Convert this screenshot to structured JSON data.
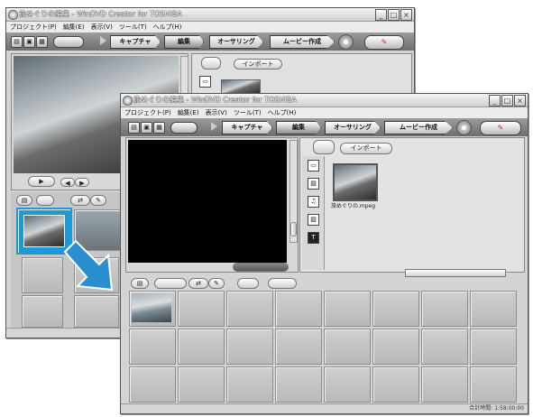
{
  "app": {
    "title": "旅めぐりの編集 - WinDVD Creator for TOSHIBA"
  },
  "menu": [
    "プロジェクト(P)",
    "編集(E)",
    "表示(V)",
    "ツール(T)",
    "ヘルプ(H)"
  ],
  "toolbar": {
    "tabs": [
      "キャプチャ",
      "編集",
      "オーサリング",
      "ムービー作成"
    ],
    "active_tab": "編集",
    "new_icon": "new-project-icon",
    "open_icon": "open-project-icon",
    "save_icon": "save-project-icon",
    "disc_icon": "disc-icon",
    "toolbox_icon": "toolbox-icon"
  },
  "media": {
    "import_label": "インポート",
    "file_name": "旅めぐりの.mpeg"
  },
  "preview": {
    "play_icon": "play-icon",
    "frame_back_icon": "frame-back-icon",
    "frame_forward_icon": "frame-forward-icon"
  },
  "storyboard": {
    "mode_icons": [
      "storyboard-view-icon",
      "timeline-view-icon",
      "ab-transition-icon",
      "edit-icon"
    ],
    "rows": 3,
    "columns": 8
  },
  "status": {
    "total_time": "合計時間: 1:58:00:00"
  },
  "colors": {
    "highlight": "#1d9ad6",
    "arrow": "#2a8fd0",
    "toolbar_dark": "#6e6e6e",
    "preview_black": "#000000"
  }
}
